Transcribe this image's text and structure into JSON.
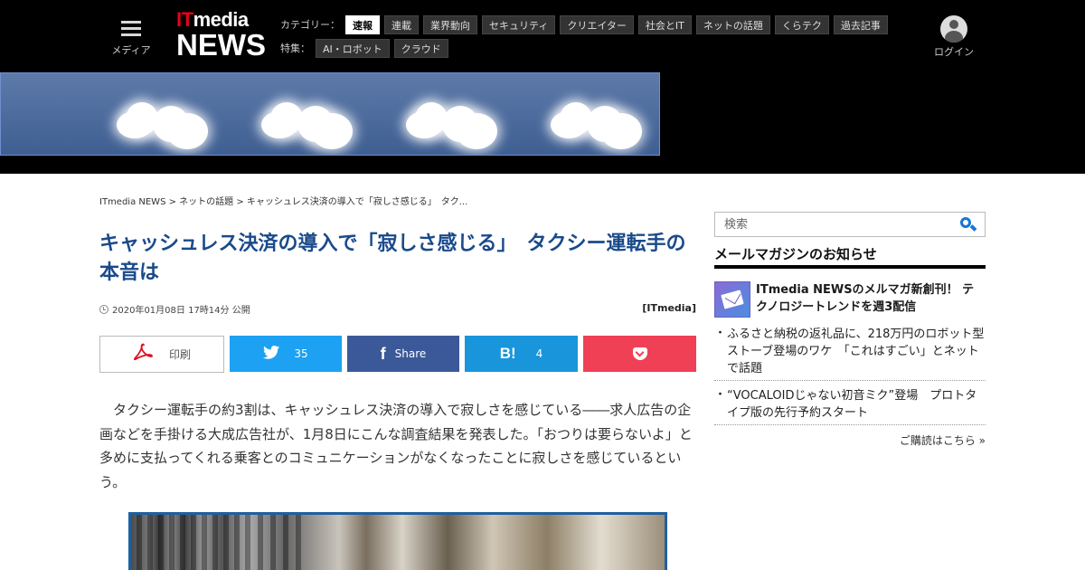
{
  "header": {
    "menu_label": "メディア",
    "logo_top": "ITmedia",
    "logo_top_accent": "IT",
    "logo_top_rest": "media",
    "logo_bottom": "NEWS",
    "category_label": "カテゴリー：",
    "categories": [
      "速報",
      "連載",
      "業界動向",
      "セキュリティ",
      "クリエイター",
      "社会とIT",
      "ネットの話題",
      "くらテク",
      "過去記事"
    ],
    "active_category": "速報",
    "feature_label": "特集：",
    "features": [
      "AI・ロボット",
      "クラウド"
    ],
    "login_label": "ログイン",
    "colors": {
      "background": "#000000",
      "logo_accent": "#e8001c"
    }
  },
  "breadcrumb": {
    "items": [
      "ITmedia NEWS",
      "ネットの話題",
      "キャッシュレス決済の導入で「寂しさ感じる」　タク..."
    ],
    "separator": " > "
  },
  "article": {
    "title": "キャッシュレス決済の導入で「寂しさ感じる」　タクシー運転手の本音は",
    "date": "2020年01月08日 17時14分 公開",
    "source": "[ITmedia]",
    "body": "タクシー運転手の約3割は、キャッシュレス決済の導入で寂しさを感じている――求人広告の企画などを手掛ける大成広告社が、1月8日にこんな調査結果を発表した。「おつりは要らないよ」と多めに支払ってくれる乗客とのコミュニケーションがなくなったことに寂しさを感じているという。",
    "colors": {
      "title": "#1a4a8a",
      "photo_border": "#1f5fa0"
    }
  },
  "share": {
    "print_label": "印刷",
    "twitter_count": "35",
    "facebook_label": "Share",
    "hatena_icon_text": "B!",
    "hatena_count": "4",
    "facebook_icon_text": "f",
    "icons": [
      "pdf-icon",
      "twitter-bird-icon",
      "facebook-icon",
      "hatena-bookmark-icon",
      "pocket-icon"
    ],
    "colors": {
      "twitter": "#1da1f2",
      "facebook": "#3b5998",
      "hatena": "#1995db",
      "pocket": "#ef4056"
    }
  },
  "sidebar": {
    "search_placeholder": "検索",
    "newsletter_title": "メールマガジンのお知らせ",
    "feature_item": "ITmedia NEWSのメルマガ新創刊！ テクノロジートレンドを週3配信",
    "items": [
      "ふるさと納税の返礼品に、218万円のロボット型ストーブ登場のワケ　「これはすごい」とネットで話題",
      "“VOCALOIDじゃない初音ミク”登場　プロトタイプ版の先行予約スタート"
    ],
    "more_link": "ご購読はこちら »",
    "colors": {
      "search_icon": "#1976d2"
    }
  }
}
